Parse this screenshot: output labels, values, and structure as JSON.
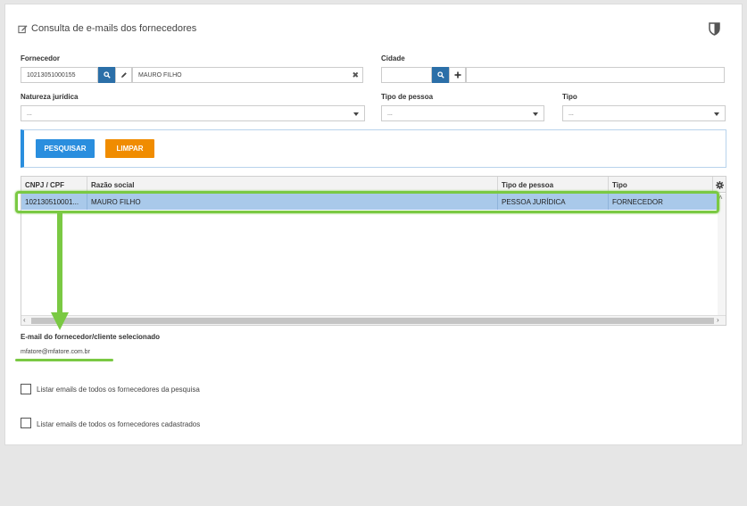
{
  "header": {
    "title": "Consulta de e-mails dos fornecedores",
    "edit_icon": "edit-icon",
    "shield_icon": "shield-icon"
  },
  "filters": {
    "supplier_label": "Fornecedor",
    "supplier_code": "10213051000155",
    "supplier_name": "MAURO FILHO",
    "city_label": "Cidade",
    "city_value": "",
    "legal_nature_label": "Natureza jurídica",
    "legal_nature_value": "...",
    "person_type_label": "Tipo de pessoa",
    "person_type_value": "...",
    "type_label": "Tipo",
    "type_value": "..."
  },
  "actions": {
    "search_label": "PESQUISAR",
    "clear_label": "LIMPAR"
  },
  "grid": {
    "columns": [
      "CNPJ / CPF",
      "Razão social",
      "Tipo de pessoa",
      "Tipo"
    ],
    "rows": [
      {
        "cnpj": "102130510001...",
        "name": "MAURO FILHO",
        "person_type": "PESSOA JURÍDICA",
        "type": "FORNECEDOR",
        "selected": true
      }
    ]
  },
  "email": {
    "label": "E-mail do fornecedor/cliente selecionado",
    "value": "mfatore@mfatore.com.br"
  },
  "options": {
    "list_search_label": "Listar emails de todos os fornecedores da pesquisa",
    "list_search_checked": false,
    "list_all_label": "Listar emails de todos os fornecedores cadastrados",
    "list_all_checked": false
  },
  "colors": {
    "primary": "#2a8ede",
    "warning": "#f08c00",
    "selection": "#a9c9ea",
    "annotation": "#7ac943"
  }
}
